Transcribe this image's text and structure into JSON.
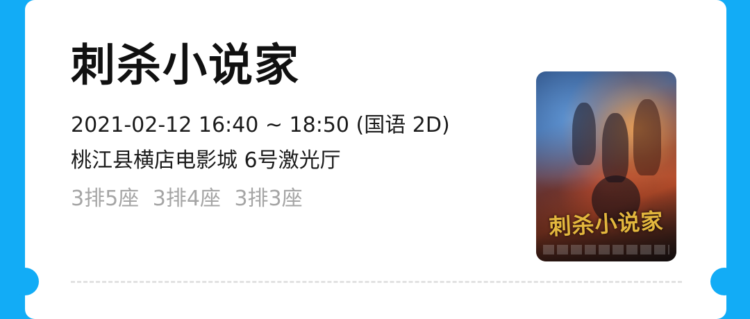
{
  "ticket": {
    "movie_title": "刺杀小说家",
    "showtime": "2021-02-12 16:40 ~ 18:50 (国语 2D)",
    "cinema": "桃江县横店电影城 6号激光厅",
    "seats": [
      "3排5座",
      "3排4座",
      "3排3座"
    ],
    "poster": {
      "title_text": "刺杀小说家"
    }
  },
  "colors": {
    "background": "#12acf6",
    "card": "#ffffff",
    "title": "#111111",
    "info_text": "#1b1b1b",
    "seat_text": "#a5a5a5",
    "poster_title": "#e3b73d"
  }
}
